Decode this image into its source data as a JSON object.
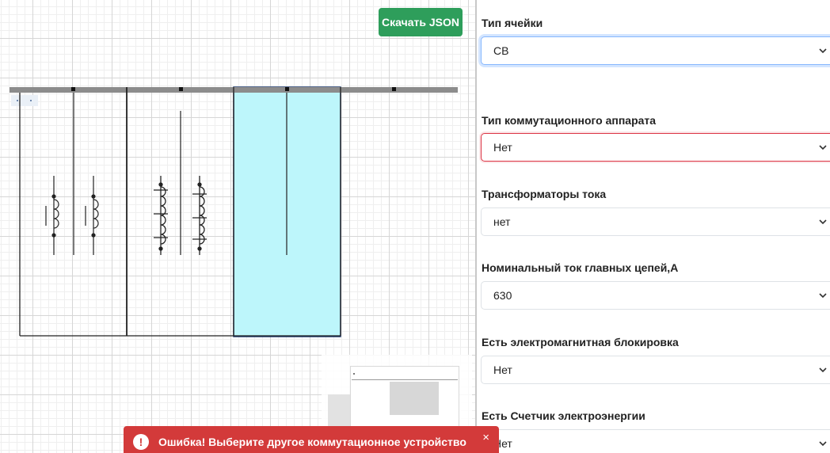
{
  "toolbar": {
    "download_label": "Скачать JSON"
  },
  "form": {
    "fields": [
      {
        "label": "Тип ячейки",
        "value": "СВ"
      },
      {
        "label": "Тип коммутационного аппарата",
        "value": "Нет"
      },
      {
        "label": "Трансформаторы тока",
        "value": "нет"
      },
      {
        "label": "Номинальный ток главных цепей,А",
        "value": "630"
      },
      {
        "label": "Есть электромагнитная блокировка",
        "value": "Нет"
      },
      {
        "label": "Есть Счетчик электроэнергии",
        "value": "Нет"
      }
    ]
  },
  "toast": {
    "message": "Ошибка! Выберите другое коммутационное устройство",
    "icon": "!",
    "close": "×"
  },
  "colors": {
    "accent_green": "#2e9e5b",
    "error_red": "#d33a3a",
    "selection_fill": "#bdf6fb",
    "selection_border": "#1f3a6e",
    "busbar": "#8c8c8c"
  },
  "icons": [
    "chevron-down-icon",
    "error-icon",
    "close-icon",
    "coil-icon"
  ]
}
